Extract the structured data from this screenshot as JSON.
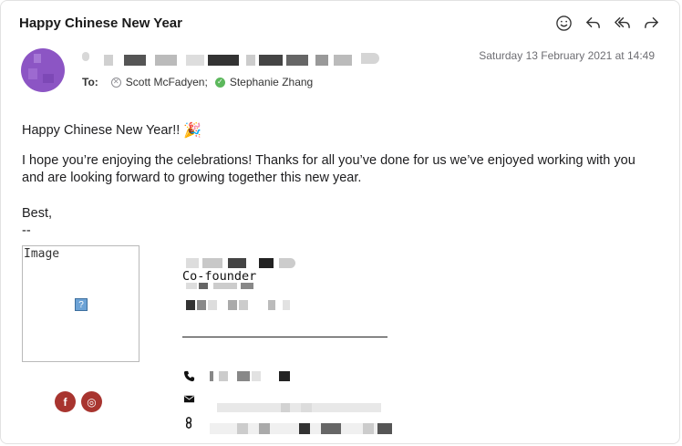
{
  "email": {
    "subject": "Happy Chinese New Year",
    "date": "Saturday 13 February 2021 at 14:49",
    "to_label": "To:",
    "recipients": [
      {
        "name": "Scott McFadyen;",
        "status": "unknown"
      },
      {
        "name": "Stephanie Zhang",
        "status": "verified"
      }
    ]
  },
  "toolbar": {
    "icons": [
      "emoji-reaction-icon",
      "reply-icon",
      "reply-all-icon",
      "forward-icon"
    ]
  },
  "body": {
    "greeting": "Happy Chinese New Year!!",
    "greeting_emoji": "🎉",
    "message": "I hope you’re enjoying the celebrations! Thanks for all you’ve done for us we’ve enjoyed working with you and are looking forward to growing together this new year.",
    "signoff": "Best,",
    "separator": "--"
  },
  "signature": {
    "image_alt": "Image",
    "broken_image_glyph": "?",
    "role": "Co-founder",
    "social": [
      {
        "icon": "facebook-icon",
        "glyph": "f"
      },
      {
        "icon": "instagram-icon",
        "glyph": "◎"
      }
    ],
    "contact_icons": [
      "phone-icon",
      "email-icon",
      "link-icon"
    ]
  },
  "colors": {
    "avatar": "#8c55c4",
    "social": "#a8342f",
    "verified": "#5cb85c"
  }
}
